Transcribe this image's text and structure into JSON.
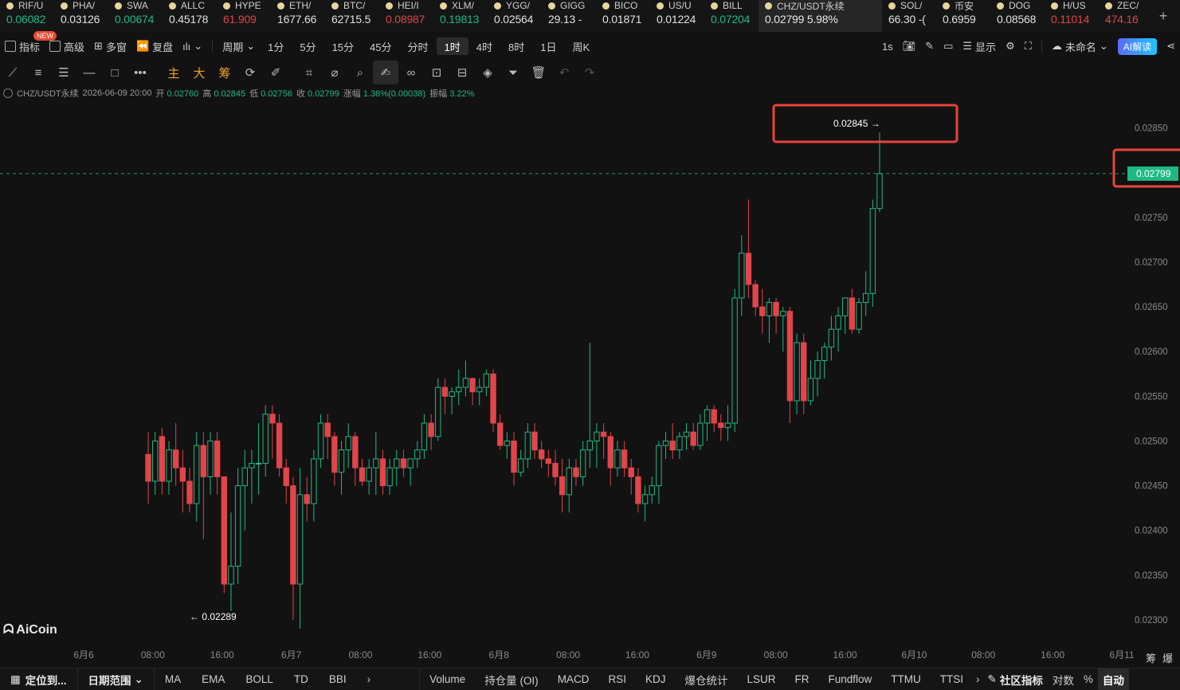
{
  "ticker": [
    {
      "name": "RIF/U",
      "price": "0.06082",
      "dir": "up"
    },
    {
      "name": "PHA/",
      "price": "0.03126",
      "dir": "neutral"
    },
    {
      "name": "SWA",
      "price": "0.00674",
      "dir": "up"
    },
    {
      "name": "ALLC",
      "price": "0.45178",
      "dir": "neutral"
    },
    {
      "name": "HYPE",
      "price": "61.909",
      "dir": "down"
    },
    {
      "name": "ETH/",
      "price": "1677.66",
      "dir": "neutral"
    },
    {
      "name": "BTC/",
      "price": "62715.5",
      "dir": "neutral"
    },
    {
      "name": "HEI/I",
      "price": "0.08987",
      "dir": "down"
    },
    {
      "name": "XLM/",
      "price": "0.19813",
      "dir": "up"
    },
    {
      "name": "YGG/",
      "price": "0.02564",
      "dir": "neutral"
    },
    {
      "name": "GIGG",
      "price": "29.13 -",
      "dir": "neutral"
    },
    {
      "name": "BICO",
      "price": "0.01871",
      "dir": "neutral"
    },
    {
      "name": "US/U",
      "price": "0.01224",
      "dir": "neutral"
    },
    {
      "name": "BILL",
      "price": "0.07204",
      "dir": "up"
    },
    {
      "name": "CHZ/USDT永续",
      "price": "0.02799 5.98%",
      "dir": "neutral",
      "active": true
    },
    {
      "name": "SOL/",
      "price": "66.30 -(",
      "dir": "neutral"
    },
    {
      "name": "币安",
      "price": "0.6959",
      "dir": "neutral"
    },
    {
      "name": "DOG",
      "price": "0.08568",
      "dir": "neutral"
    },
    {
      "name": "H/US",
      "price": "0.11014",
      "dir": "down"
    },
    {
      "name": "ZEC/",
      "price": "474.16",
      "dir": "down"
    }
  ],
  "ticker_add": "+",
  "toolbar": {
    "indicators": "指标",
    "new_badge": "NEW",
    "advanced": "高级",
    "multi_window": "多窗",
    "replay": "复盘",
    "period": "周期",
    "periods": [
      "1分",
      "5分",
      "15分",
      "45分",
      "分时",
      "1时",
      "4时",
      "8时",
      "1日",
      "周K"
    ],
    "active_period": "1时",
    "refresh": "1s",
    "display": "显示",
    "unnamed": "未命名",
    "ai": "AI解读"
  },
  "drawing_tools": {
    "main": "主",
    "big": "大",
    "chips": "筹"
  },
  "info": {
    "symbol": "CHZ/USDT永续",
    "datetime": "2026-06-09 20:00",
    "open_label": "开",
    "open": "0.02760",
    "high_label": "高",
    "high": "0.02845",
    "low_label": "低",
    "low": "0.02756",
    "close_label": "收",
    "close": "0.02799",
    "change_label": "涨幅",
    "change": "1.38%(0.00038)",
    "amp_label": "振幅",
    "amp": "3.22%"
  },
  "chart_data": {
    "type": "candlestick",
    "y_ticks": [
      "0.02850",
      "0.02800",
      "0.02750",
      "0.02700",
      "0.02650",
      "0.02600",
      "0.02550",
      "0.02500",
      "0.02450",
      "0.02400",
      "0.02350",
      "0.02300"
    ],
    "ylim": [
      0.02275,
      0.0288
    ],
    "x_ticks": [
      "6月6",
      "08:00",
      "16:00",
      "6月7",
      "08:00",
      "16:00",
      "6月8",
      "08:00",
      "16:00",
      "6月9",
      "08:00",
      "16:00",
      "6月10",
      "08:00",
      "16:00",
      "6月11"
    ],
    "current_price": "0.02799",
    "high_marker": "0.02845 →",
    "low_marker": "← 0.02289",
    "colors": {
      "up": "#1fb985",
      "down": "#e0454a",
      "annotation": "#e8443a"
    },
    "candles": [
      [
        0.02485,
        0.0251,
        0.0243,
        0.02455
      ],
      [
        0.02455,
        0.0251,
        0.0244,
        0.025
      ],
      [
        0.02505,
        0.02515,
        0.0244,
        0.02455
      ],
      [
        0.02455,
        0.025,
        0.0244,
        0.0249
      ],
      [
        0.0249,
        0.0252,
        0.0245,
        0.0247
      ],
      [
        0.0247,
        0.0249,
        0.0242,
        0.02455
      ],
      [
        0.02455,
        0.0247,
        0.0242,
        0.0243
      ],
      [
        0.0243,
        0.0251,
        0.0241,
        0.02495
      ],
      [
        0.02495,
        0.0251,
        0.0239,
        0.0246
      ],
      [
        0.0246,
        0.0251,
        0.0244,
        0.025
      ],
      [
        0.025,
        0.0251,
        0.0244,
        0.0246
      ],
      [
        0.0246,
        0.0246,
        0.0233,
        0.0234
      ],
      [
        0.0234,
        0.0242,
        0.0231,
        0.0236
      ],
      [
        0.0236,
        0.0247,
        0.0234,
        0.0245
      ],
      [
        0.0245,
        0.0249,
        0.024,
        0.0247
      ],
      [
        0.0247,
        0.0249,
        0.0243,
        0.02475
      ],
      [
        0.02475,
        0.0252,
        0.0244,
        0.02475
      ],
      [
        0.02475,
        0.0254,
        0.0246,
        0.0253
      ],
      [
        0.0253,
        0.0254,
        0.0248,
        0.0252
      ],
      [
        0.0252,
        0.0253,
        0.0246,
        0.0247
      ],
      [
        0.0247,
        0.0248,
        0.0243,
        0.0245
      ],
      [
        0.0245,
        0.0246,
        0.023,
        0.0234
      ],
      [
        0.0234,
        0.0247,
        0.0229,
        0.0244
      ],
      [
        0.0244,
        0.0246,
        0.0241,
        0.0243
      ],
      [
        0.0243,
        0.0249,
        0.0241,
        0.0248
      ],
      [
        0.0248,
        0.0253,
        0.0247,
        0.0252
      ],
      [
        0.0252,
        0.0253,
        0.0248,
        0.02505
      ],
      [
        0.02505,
        0.0251,
        0.0245,
        0.02465
      ],
      [
        0.02465,
        0.025,
        0.0244,
        0.0249
      ],
      [
        0.0249,
        0.0252,
        0.0247,
        0.02505
      ],
      [
        0.02505,
        0.0251,
        0.0245,
        0.0247
      ],
      [
        0.0247,
        0.0248,
        0.0245,
        0.02455
      ],
      [
        0.02455,
        0.0248,
        0.0244,
        0.0247
      ],
      [
        0.0247,
        0.0251,
        0.0244,
        0.0248
      ],
      [
        0.0248,
        0.0249,
        0.0244,
        0.0245
      ],
      [
        0.0245,
        0.0248,
        0.0244,
        0.0247
      ],
      [
        0.0247,
        0.0249,
        0.0245,
        0.0248
      ],
      [
        0.0248,
        0.0249,
        0.0246,
        0.0247
      ],
      [
        0.0247,
        0.0248,
        0.0245,
        0.0248
      ],
      [
        0.0248,
        0.025,
        0.0247,
        0.0249
      ],
      [
        0.0249,
        0.0253,
        0.0248,
        0.0252
      ],
      [
        0.0252,
        0.0253,
        0.0249,
        0.02505
      ],
      [
        0.02505,
        0.0257,
        0.025,
        0.0256
      ],
      [
        0.0256,
        0.0257,
        0.0253,
        0.0255
      ],
      [
        0.0255,
        0.0256,
        0.0253,
        0.02555
      ],
      [
        0.02555,
        0.0258,
        0.0254,
        0.0256
      ],
      [
        0.0256,
        0.0259,
        0.0255,
        0.0257
      ],
      [
        0.0257,
        0.0257,
        0.0254,
        0.02555
      ],
      [
        0.02555,
        0.0257,
        0.0254,
        0.0256
      ],
      [
        0.0256,
        0.0258,
        0.0255,
        0.02575
      ],
      [
        0.02575,
        0.0258,
        0.0251,
        0.0252
      ],
      [
        0.0252,
        0.0253,
        0.0249,
        0.02495
      ],
      [
        0.02495,
        0.0251,
        0.0248,
        0.025
      ],
      [
        0.025,
        0.0251,
        0.0245,
        0.02465
      ],
      [
        0.02465,
        0.0249,
        0.0246,
        0.0248
      ],
      [
        0.0248,
        0.0252,
        0.0247,
        0.0251
      ],
      [
        0.0251,
        0.0252,
        0.0248,
        0.0249
      ],
      [
        0.0249,
        0.025,
        0.0247,
        0.0248
      ],
      [
        0.0248,
        0.0249,
        0.0246,
        0.02475
      ],
      [
        0.02475,
        0.0249,
        0.0245,
        0.0246
      ],
      [
        0.0246,
        0.0248,
        0.0242,
        0.0244
      ],
      [
        0.0244,
        0.0248,
        0.0242,
        0.0247
      ],
      [
        0.0247,
        0.0248,
        0.0245,
        0.0246
      ],
      [
        0.0246,
        0.025,
        0.0245,
        0.0249
      ],
      [
        0.0249,
        0.0261,
        0.0247,
        0.025
      ],
      [
        0.025,
        0.0252,
        0.0247,
        0.0251
      ],
      [
        0.0251,
        0.0252,
        0.0248,
        0.02505
      ],
      [
        0.02505,
        0.0251,
        0.0245,
        0.0247
      ],
      [
        0.0247,
        0.025,
        0.0246,
        0.0249
      ],
      [
        0.0249,
        0.025,
        0.0246,
        0.0247
      ],
      [
        0.0247,
        0.0248,
        0.0244,
        0.0246
      ],
      [
        0.0246,
        0.0247,
        0.0242,
        0.0243
      ],
      [
        0.0243,
        0.0245,
        0.0241,
        0.0244
      ],
      [
        0.0244,
        0.0246,
        0.0243,
        0.0245
      ],
      [
        0.0245,
        0.025,
        0.0243,
        0.02495
      ],
      [
        0.02495,
        0.0251,
        0.0248,
        0.025
      ],
      [
        0.025,
        0.0252,
        0.0248,
        0.0249
      ],
      [
        0.0249,
        0.0251,
        0.0248,
        0.02505
      ],
      [
        0.02505,
        0.0252,
        0.0249,
        0.0251
      ],
      [
        0.0251,
        0.0252,
        0.0249,
        0.02495
      ],
      [
        0.02495,
        0.0253,
        0.0249,
        0.0252
      ],
      [
        0.0252,
        0.0254,
        0.025,
        0.02535
      ],
      [
        0.02535,
        0.0254,
        0.0251,
        0.0252
      ],
      [
        0.0252,
        0.0253,
        0.025,
        0.02515
      ],
      [
        0.02515,
        0.0254,
        0.025,
        0.0252
      ],
      [
        0.0252,
        0.0267,
        0.0251,
        0.0266
      ],
      [
        0.0266,
        0.0273,
        0.0264,
        0.0271
      ],
      [
        0.0271,
        0.0277,
        0.0266,
        0.02675
      ],
      [
        0.02675,
        0.0268,
        0.0264,
        0.0265
      ],
      [
        0.0265,
        0.0267,
        0.0262,
        0.0264
      ],
      [
        0.0264,
        0.0266,
        0.0261,
        0.02655
      ],
      [
        0.02655,
        0.0266,
        0.0262,
        0.0264
      ],
      [
        0.0264,
        0.0265,
        0.026,
        0.02645
      ],
      [
        0.02645,
        0.0265,
        0.0252,
        0.02545
      ],
      [
        0.02545,
        0.0262,
        0.0253,
        0.0261
      ],
      [
        0.0261,
        0.0262,
        0.0253,
        0.02545
      ],
      [
        0.02545,
        0.0259,
        0.0254,
        0.0257
      ],
      [
        0.0257,
        0.026,
        0.0255,
        0.0259
      ],
      [
        0.0259,
        0.0261,
        0.0257,
        0.02605
      ],
      [
        0.02605,
        0.0264,
        0.0259,
        0.02625
      ],
      [
        0.02625,
        0.0265,
        0.026,
        0.0264
      ],
      [
        0.0264,
        0.0266,
        0.0262,
        0.0266
      ],
      [
        0.0266,
        0.0267,
        0.0262,
        0.02625
      ],
      [
        0.02625,
        0.0266,
        0.0262,
        0.02655
      ],
      [
        0.02655,
        0.0269,
        0.0264,
        0.02665
      ],
      [
        0.02665,
        0.0277,
        0.0265,
        0.0276
      ],
      [
        0.0276,
        0.02845,
        0.02756,
        0.02799
      ]
    ]
  },
  "logo": "AiCoin",
  "bottom": {
    "locate": "定位到...",
    "date_range": "日期范围",
    "indicators": [
      "MA",
      "EMA",
      "BOLL",
      "TD",
      "BBI"
    ],
    "sub_indicators": [
      "Volume",
      "持仓量 (OI)",
      "MACD",
      "RSI",
      "KDJ",
      "爆仓统计",
      "LSUR",
      "FR",
      "Fundflow",
      "TTMU",
      "TTSI"
    ],
    "community": "社区指标",
    "log": "对数",
    "percent": "%",
    "auto": "自动",
    "chips_side": "筹",
    "burst_side": "爆"
  }
}
